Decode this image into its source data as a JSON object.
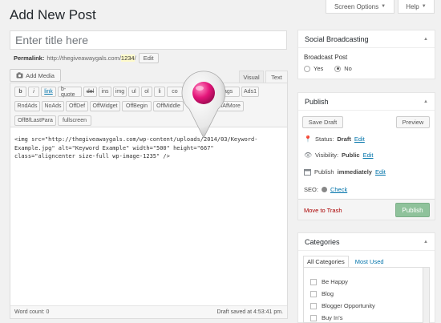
{
  "header": {
    "title": "Add New Post",
    "screen_options": "Screen Options",
    "help": "Help"
  },
  "editor": {
    "title_placeholder": "Enter title here",
    "permalink_label": "Permalink:",
    "permalink_base": "http://thegiveawaygals.com/",
    "permalink_slug": "1234",
    "edit_btn": "Edit",
    "add_media": "Add Media",
    "tab_visual": "Visual",
    "tab_text": "Text",
    "quicktags_row1": [
      "b",
      "i",
      "link",
      "b-quote",
      "del",
      "ins",
      "img",
      "ul",
      "ol",
      "li",
      "co",
      "se tags",
      "Ads1"
    ],
    "quicktags_row2": [
      "RndAds",
      "NoAds",
      "OffDef",
      "OffWidget",
      "OffBegin",
      "OffMiddle",
      "OffAfMore"
    ],
    "quicktags_row3": [
      "OffBfLastPara",
      "fullscreen"
    ],
    "content_line1": "<img src=\"http://thegiveawaygals.com/wp-content/uploads/2014/03/Keyword-",
    "content_line2": "Example.jpg\" alt=\"Keyword Example\" width=\"500\" height=\"667\"",
    "content_line3": "class=\"aligncenter size-full wp-image-1235\" />",
    "word_count": "Word count: 0",
    "draft_saved": "Draft saved at 4:53:41 pm."
  },
  "social": {
    "title": "Social Broadcasting",
    "label": "Broadcast Post",
    "yes": "Yes",
    "no": "No",
    "selected": "No"
  },
  "publish": {
    "title": "Publish",
    "save_draft": "Save Draft",
    "preview": "Preview",
    "status_label": "Status:",
    "status_value": "Draft",
    "visibility_label": "Visibility:",
    "visibility_value": "Public",
    "publish_label": "Publish",
    "publish_value": "immediately",
    "edit": "Edit",
    "seo_label": "SEO:",
    "seo_check": "Check",
    "trash": "Move to Trash",
    "publish_btn": "Publish"
  },
  "categories": {
    "title": "Categories",
    "tab_all": "All Categories",
    "tab_most_used": "Most Used",
    "items": [
      "Be Happy",
      "Blog",
      "Blogger Opportunity",
      "Buy In's"
    ]
  },
  "colors": {
    "accent": "#0073aa",
    "pin": "#e4157a",
    "publish_btn": "#8fc29b"
  },
  "icons": {
    "location_pin": "map-pin-icon",
    "media": "camera-icon"
  }
}
